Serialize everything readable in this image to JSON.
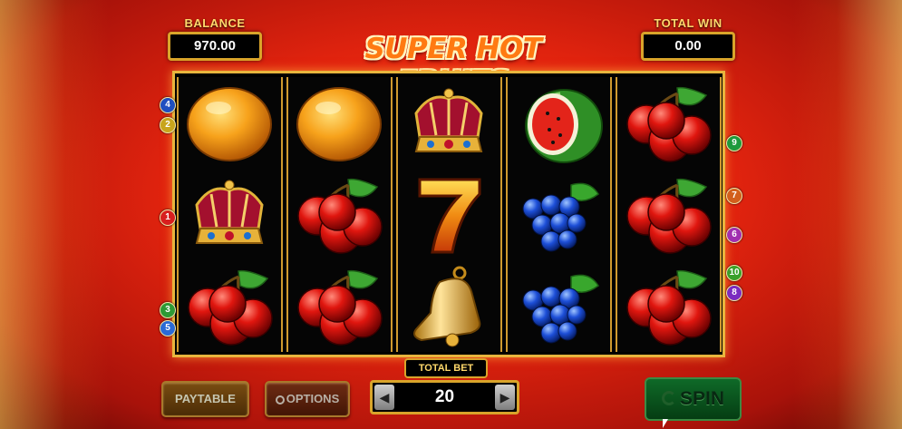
{
  "balance": {
    "label": "BALANCE",
    "value": "970.00"
  },
  "total_win": {
    "label": "TOTAL WIN",
    "value": "0.00"
  },
  "logo": {
    "text": "SUPER HOT FRUITS"
  },
  "reels": [
    [
      "orange",
      "crown",
      "cherry"
    ],
    [
      "orange",
      "cherry",
      "cherry"
    ],
    [
      "crown",
      "seven",
      "bell"
    ],
    [
      "watermelon",
      "grapes",
      "grapes"
    ],
    [
      "cherry",
      "cherry",
      "cherry"
    ]
  ],
  "paylines": {
    "left": [
      "4",
      "2",
      "1",
      "3",
      "5"
    ],
    "right": [
      "9",
      "7",
      "6",
      "10",
      "8"
    ],
    "colors": {
      "1": "#d81e1e",
      "2": "#c8a41c",
      "3": "#2e9a35",
      "4": "#1f4fc0",
      "5": "#2a6ad6",
      "6": "#a12fb0",
      "7": "#d25f1c",
      "8": "#7a2bc0",
      "9": "#1d9a3c",
      "10": "#3aa02a"
    }
  },
  "controls": {
    "paytable": "PAYTABLE",
    "options": "OPTIONS",
    "total_bet_label": "TOTAL BET",
    "total_bet_value": "20",
    "spin": "SPIN",
    "decrease_icon": "arrow-left-icon",
    "increase_icon": "arrow-right-icon"
  }
}
